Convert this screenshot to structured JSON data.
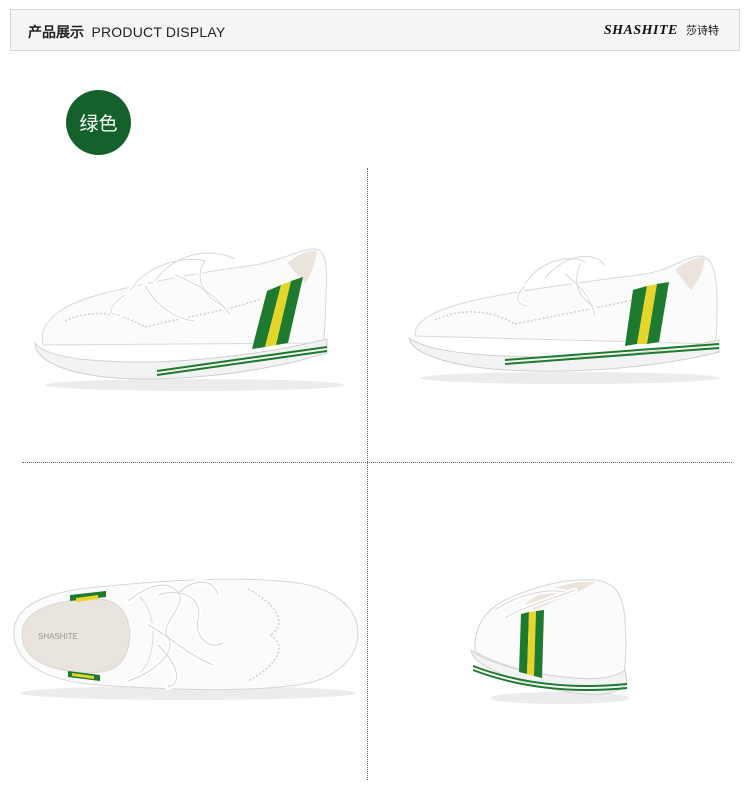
{
  "header": {
    "title_zh": "产品展示",
    "title_en": "PRODUCT DISPLAY",
    "brand_logo": "SHASHITE",
    "brand_cn": "莎诗特"
  },
  "color_badge": {
    "label": "绿色",
    "color": "#15612c"
  },
  "accent_colors": {
    "green_stripe": "#1d7a2e",
    "yellow_stripe": "#e5d52a"
  },
  "photos": [
    "side-view-left",
    "side-view-right",
    "top-view",
    "back-view"
  ],
  "insole_print": "SHASHITE"
}
